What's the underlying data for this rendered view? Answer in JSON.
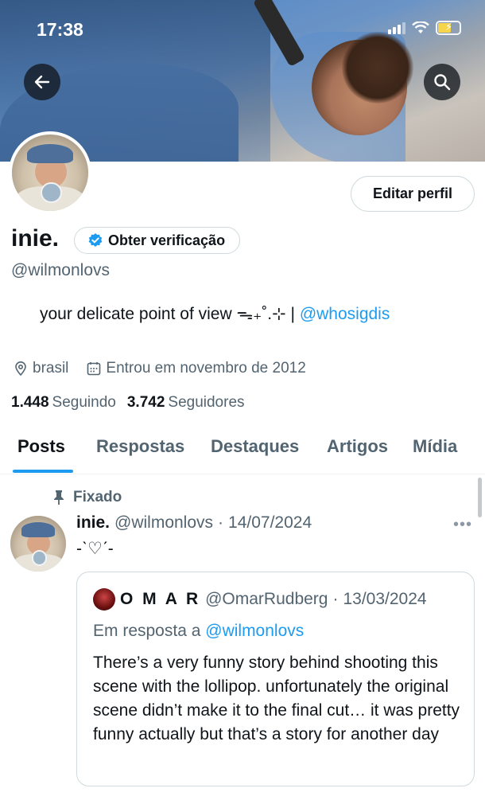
{
  "status_bar": {
    "time": "17:38"
  },
  "header": {
    "back_icon": "arrow-left-icon",
    "search_icon": "search-icon"
  },
  "profile": {
    "edit_button": "Editar perfil",
    "name": "inie.",
    "verify_button": "Obter verificação",
    "handle": "@wilmonlovs",
    "bio_text": "your delicate point of view ᯓ₊˚.⊹ | ",
    "bio_link": "@whosigdis",
    "location": "brasil",
    "joined": "Entrou em novembro de 2012",
    "following_count": "1.448",
    "following_label": "Seguindo",
    "followers_count": "3.742",
    "followers_label": "Seguidores"
  },
  "tabs": [
    {
      "label": "Posts",
      "active": true
    },
    {
      "label": "Respostas",
      "active": false
    },
    {
      "label": "Destaques",
      "active": false
    },
    {
      "label": "Artigos",
      "active": false
    },
    {
      "label": "Mídia",
      "active": false
    }
  ],
  "pinned_post": {
    "pinned_label": "Fixado",
    "author_name": "inie.",
    "author_handle": "@wilmonlovs",
    "separator": "·",
    "date": "14/07/2024",
    "more_label": "•••",
    "text": "-ˋ♡ˊ-",
    "quote": {
      "author_name": "O M A R",
      "author_handle": "@OmarRudberg",
      "separator": "·",
      "date": "13/03/2024",
      "reply_prefix": "Em resposta a",
      "reply_handle": "@wilmonlovs",
      "text": "There’s a very funny story behind shooting this scene with the lollipop. unfortunately the original scene didn’t make it to the final cut… it was pretty funny actually but that’s a story for another day"
    }
  },
  "colors": {
    "accent": "#1d9bf0",
    "text": "#0f1419",
    "secondary": "#536471",
    "border": "#cfd9de"
  }
}
